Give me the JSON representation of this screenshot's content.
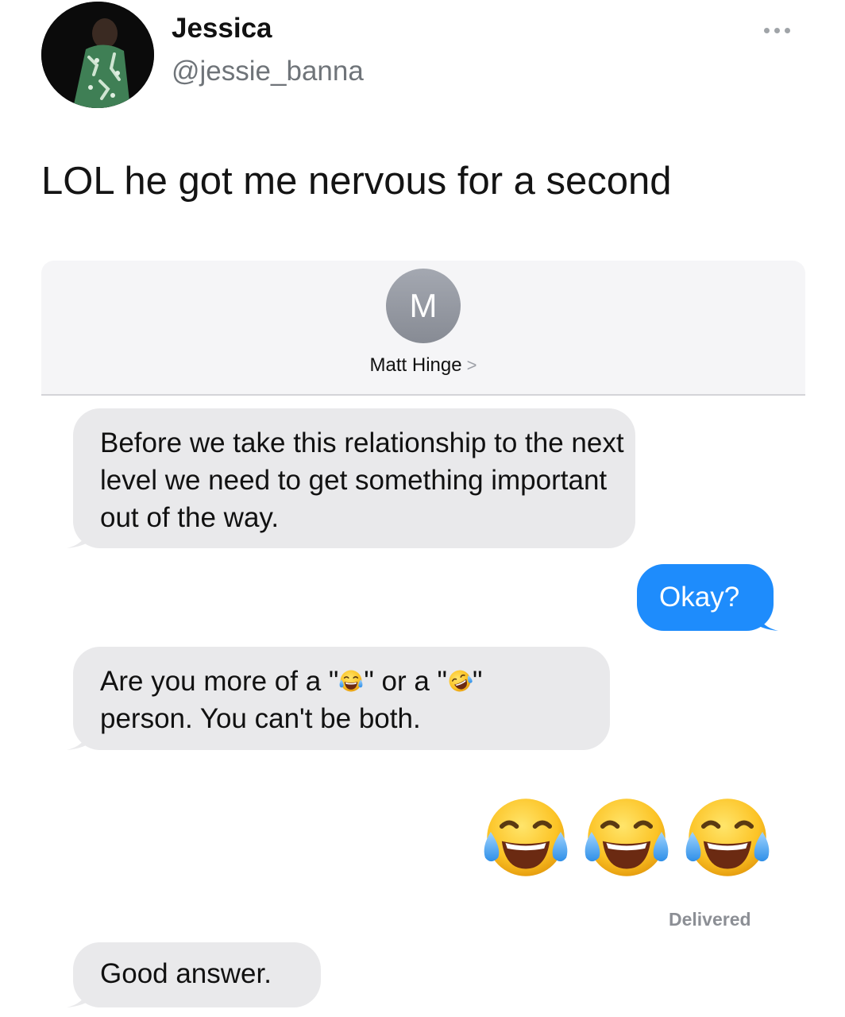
{
  "tweet": {
    "author_name": "Jessica",
    "author_handle": "@jessie_banna",
    "text": "LOL he got me nervous for a second",
    "more_icon": "more-horizontal-icon"
  },
  "imessage": {
    "contact": {
      "initial": "M",
      "name": "Matt Hinge",
      "chevron": ">"
    },
    "messages": [
      {
        "direction": "received",
        "text": "Before we take this relationship to the next level we need to get something important out of the way."
      },
      {
        "direction": "sent",
        "text": "Okay?"
      },
      {
        "direction": "received",
        "parts": {
          "a": "Are you more of a \"",
          "emoji_1": "face-with-tears-of-joy",
          "b": "\" or a \"",
          "emoji_2": "rolling-on-the-floor-laughing",
          "c": "\"",
          "d": "person. You can't be both."
        }
      },
      {
        "direction": "sent",
        "emoji": [
          "face-with-tears-of-joy",
          "face-with-tears-of-joy",
          "face-with-tears-of-joy"
        ],
        "status": "Delivered"
      },
      {
        "direction": "received",
        "text": "Good answer."
      }
    ]
  },
  "colors": {
    "received_bubble": "#e9e9eb",
    "sent_bubble": "#1e8cfc",
    "handle_gray": "#6f7479"
  }
}
